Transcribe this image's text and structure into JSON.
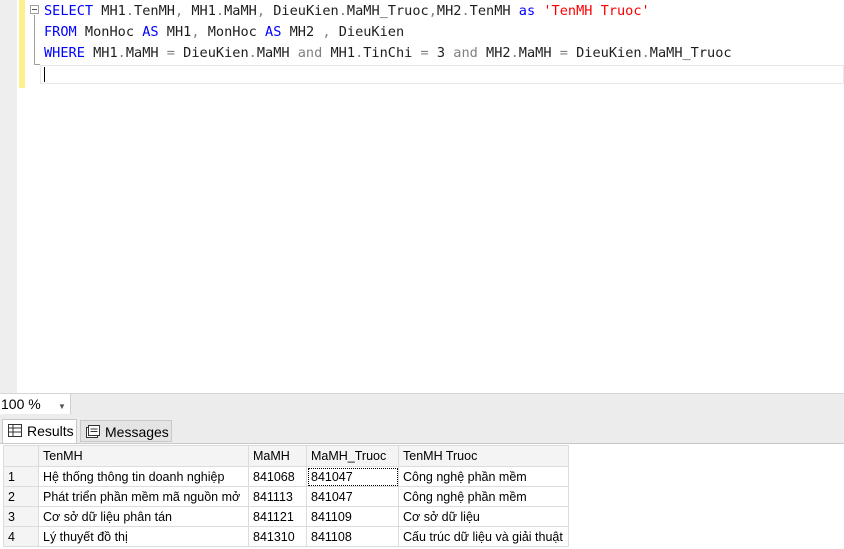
{
  "editor": {
    "line1": [
      {
        "t": "SELECT",
        "c": "kw"
      },
      {
        "t": " MH1",
        "c": ""
      },
      {
        "t": ".",
        "c": "op"
      },
      {
        "t": "TenMH",
        "c": ""
      },
      {
        "t": ",",
        "c": "op"
      },
      {
        "t": " MH1",
        "c": ""
      },
      {
        "t": ".",
        "c": "op"
      },
      {
        "t": "MaMH",
        "c": ""
      },
      {
        "t": ",",
        "c": "op"
      },
      {
        "t": " DieuKien",
        "c": ""
      },
      {
        "t": ".",
        "c": "op"
      },
      {
        "t": "MaMH_Truoc",
        "c": ""
      },
      {
        "t": ",",
        "c": "op"
      },
      {
        "t": "MH2",
        "c": ""
      },
      {
        "t": ".",
        "c": "op"
      },
      {
        "t": "TenMH ",
        "c": ""
      },
      {
        "t": "as",
        "c": "kw"
      },
      {
        "t": " ",
        "c": ""
      },
      {
        "t": "'TenMH Truoc'",
        "c": "str"
      }
    ],
    "line2": [
      {
        "t": "FROM",
        "c": "kw"
      },
      {
        "t": " MonHoc ",
        "c": ""
      },
      {
        "t": "AS",
        "c": "kw"
      },
      {
        "t": " MH1",
        "c": ""
      },
      {
        "t": ",",
        "c": "op"
      },
      {
        "t": " MonHoc ",
        "c": ""
      },
      {
        "t": "AS",
        "c": "kw"
      },
      {
        "t": " MH2 ",
        "c": ""
      },
      {
        "t": ",",
        "c": "op"
      },
      {
        "t": " DieuKien",
        "c": ""
      }
    ],
    "line3": [
      {
        "t": "WHERE",
        "c": "kw"
      },
      {
        "t": " MH1",
        "c": ""
      },
      {
        "t": ".",
        "c": "op"
      },
      {
        "t": "MaMH ",
        "c": ""
      },
      {
        "t": "=",
        "c": "op"
      },
      {
        "t": " DieuKien",
        "c": ""
      },
      {
        "t": ".",
        "c": "op"
      },
      {
        "t": "MaMH ",
        "c": ""
      },
      {
        "t": "and",
        "c": "op"
      },
      {
        "t": " MH1",
        "c": ""
      },
      {
        "t": ".",
        "c": "op"
      },
      {
        "t": "TinChi ",
        "c": ""
      },
      {
        "t": "=",
        "c": "op"
      },
      {
        "t": " 3 ",
        "c": ""
      },
      {
        "t": "and",
        "c": "op"
      },
      {
        "t": " MH2",
        "c": ""
      },
      {
        "t": ".",
        "c": "op"
      },
      {
        "t": "MaMH ",
        "c": ""
      },
      {
        "t": "=",
        "c": "op"
      },
      {
        "t": " DieuKien",
        "c": ""
      },
      {
        "t": ".",
        "c": "op"
      },
      {
        "t": "MaMH_Truoc",
        "c": ""
      }
    ]
  },
  "zoom": {
    "value": "100 %"
  },
  "tabs": {
    "results_label": "Results",
    "messages_label": "Messages"
  },
  "grid": {
    "columns": [
      "TenMH",
      "MaMH",
      "MaMH_Truoc",
      "TenMH Truoc"
    ],
    "rows": [
      {
        "num": "1",
        "TenMH": "Hệ thống thông tin doanh nghiệp",
        "MaMH": "841068",
        "MaMH_Truoc": "841047",
        "TenMH_Truoc": "Công nghệ phần mềm"
      },
      {
        "num": "2",
        "TenMH": "Phát triển phần mềm mã nguồn mở",
        "MaMH": "841113",
        "MaMH_Truoc": "841047",
        "TenMH_Truoc": "Công nghệ phần mềm"
      },
      {
        "num": "3",
        "TenMH": "Cơ sở dữ liệu phân tán",
        "MaMH": "841121",
        "MaMH_Truoc": "841109",
        "TenMH_Truoc": "Cơ sở dữ liệu"
      },
      {
        "num": "4",
        "TenMH": "Lý thuyết đồ thị",
        "MaMH": "841310",
        "MaMH_Truoc": "841108",
        "TenMH_Truoc": "Cấu trúc dữ liệu và giải thuật"
      }
    ]
  },
  "colors": {
    "keyword": "#0000ff",
    "operator": "#808080",
    "string": "#ff0000",
    "margin_change": "#fbf08b"
  },
  "icons": {
    "results": "grid-icon",
    "messages": "messages-icon",
    "zoom_dropdown": "chevron-down-icon"
  }
}
